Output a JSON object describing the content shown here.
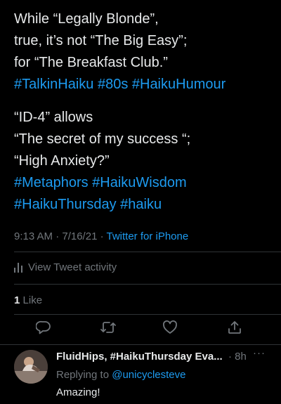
{
  "tweet": {
    "lines": [
      "While “Legally Blonde”,",
      "true, it’s not “The Big Easy”;",
      "for “The Breakfast Club.”",
      "#TalkinHaiku #80s #HaikuHumour",
      "“ID-4” allows",
      "“The secret of my success “;",
      "“High Anxiety?”",
      "#Metaphors #HaikuWisdom",
      "#HaikuThursday #haiku"
    ],
    "time": "9:13 AM · 7/16/21 · ",
    "source": "Twitter for iPhone"
  },
  "activity": {
    "label": "View Tweet activity",
    "icon": "bar-chart-icon"
  },
  "likes": {
    "count": "1",
    "label": "Like"
  },
  "actions": {
    "reply_icon": "reply-icon",
    "retweet_icon": "retweet-icon",
    "like_icon": "heart-icon",
    "share_icon": "share-icon"
  },
  "reply": {
    "name": "FluidHips, #HaikuThursday Eva...",
    "time": "· 8h",
    "more": "···",
    "replying_prefix": "Replying to ",
    "replying_handle": "@unicyclesteve",
    "text": "Amazing!"
  },
  "colors": {
    "background": "#000000",
    "text": "#e7e9ea",
    "secondary": "#71767b",
    "accent": "#1d9bf0",
    "divider": "#2f3336"
  }
}
